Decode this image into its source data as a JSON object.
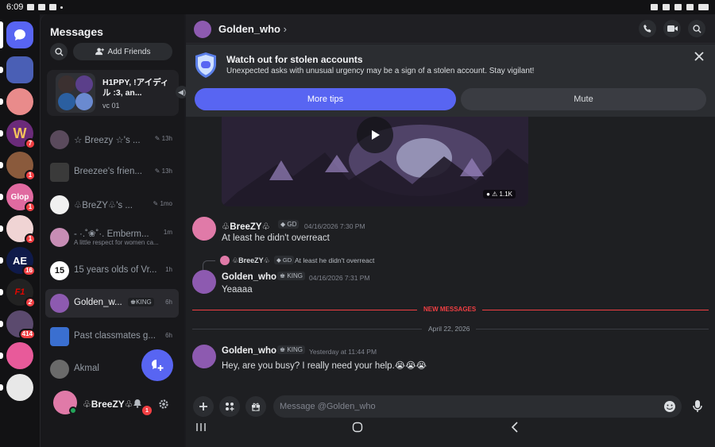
{
  "status_bar": {
    "time": "6:09"
  },
  "colors": {
    "accent": "#5865f2",
    "danger": "#f23f43",
    "online": "#23a55a"
  },
  "rail": {
    "servers": [
      {
        "name": "server-1",
        "badge": ""
      },
      {
        "name": "server-2",
        "badge": ""
      },
      {
        "name": "server-w",
        "badge": "7"
      },
      {
        "name": "server-4",
        "badge": "1"
      },
      {
        "name": "server-glop",
        "badge": "1"
      },
      {
        "name": "server-6",
        "badge": "1"
      },
      {
        "name": "server-ae",
        "badge": "16"
      },
      {
        "name": "server-f1",
        "badge": "2"
      },
      {
        "name": "server-9",
        "badge": "414"
      },
      {
        "name": "server-10",
        "badge": ""
      },
      {
        "name": "server-11",
        "badge": ""
      }
    ]
  },
  "dm": {
    "title": "Messages",
    "add_friends": "Add Friends",
    "group": {
      "name": "H1PPY, !アイディル :3, an...",
      "sub": "vc 01"
    },
    "items": [
      {
        "name": "☆ Breezy ☆'s ...",
        "time": "13h"
      },
      {
        "name": "Breezee's frien...",
        "time": "13h"
      },
      {
        "name": "♧BreZY♧'s ...",
        "time": "1mo"
      },
      {
        "name": "- ·.˚❀˚·. Emberm...",
        "sub": "A little respect for women ca...",
        "time": "1m"
      },
      {
        "name": "15 years olds of Vr...",
        "time": "1h"
      },
      {
        "name": "Golden_w...",
        "tag": "KING",
        "time": "6h"
      },
      {
        "name": "Past classmates g...",
        "time": "6h"
      },
      {
        "name": "Akmal",
        "time": ""
      }
    ],
    "group_number": "15"
  },
  "me": {
    "name": "♧BreeZY♧",
    "notif_count": "1"
  },
  "chat": {
    "header_name": "Golden_who",
    "banner": {
      "title": "Watch out for stolen accounts",
      "text": "Unexpected asks with unusual urgency may be a sign of a stolen account. Stay vigilant!",
      "tips_btn": "More tips",
      "mute_btn": "Mute"
    },
    "video": {
      "views": "1.1K"
    },
    "messages": [
      {
        "author": "♧BreeZY♧",
        "tag": "GD",
        "time": "04/16/2026 7:30 PM",
        "text": "At least he didn't overreact"
      },
      {
        "reply_author": "♧BreeZY♧",
        "reply_tag": "GD",
        "reply_text": "At least he didn't overreact",
        "author": "Golden_who",
        "tag": "KING",
        "time": "04/16/2026 7:31 PM",
        "text": "Yeaaaa"
      },
      {
        "author": "Golden_who",
        "tag": "KING",
        "time": "Yesterday at 11:44 PM",
        "text": "Hey, are you busy? I really need your help.😭😭😭"
      }
    ],
    "new_messages_label": "NEW MESSAGES",
    "date_label": "April 22, 2026",
    "composer_placeholder": "Message @Golden_who"
  }
}
